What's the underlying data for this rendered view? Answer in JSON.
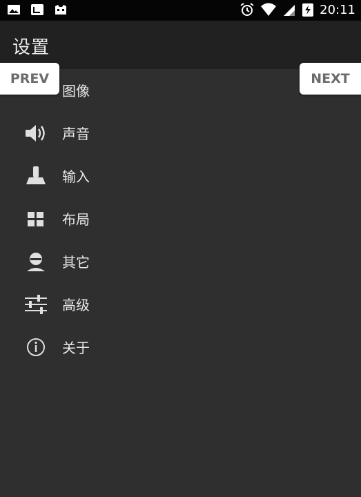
{
  "status_bar": {
    "time": "20:11",
    "left_icons": [
      "image-icon",
      "screenshot-icon",
      "cat-icon"
    ],
    "right_icons": [
      "alarm-icon",
      "wifi-icon",
      "signal-icon",
      "battery-icon"
    ]
  },
  "appbar": {
    "title": "设置"
  },
  "menu": {
    "items": [
      {
        "label": "图像",
        "icon": "display-icon"
      },
      {
        "label": "声音",
        "icon": "speaker-icon"
      },
      {
        "label": "输入",
        "icon": "joystick-icon"
      },
      {
        "label": "布局",
        "icon": "grid-icon"
      },
      {
        "label": "其它",
        "icon": "person-icon"
      },
      {
        "label": "高级",
        "icon": "sliders-icon"
      },
      {
        "label": "关于",
        "icon": "info-icon"
      }
    ]
  },
  "nav": {
    "prev_label": "PREV",
    "next_label": "NEXT"
  },
  "colors": {
    "background": "#2f2f2f",
    "appbar": "#212121",
    "statusbar": "#050505",
    "button_bg": "#ffffff",
    "button_text": "#6b6b6b"
  }
}
